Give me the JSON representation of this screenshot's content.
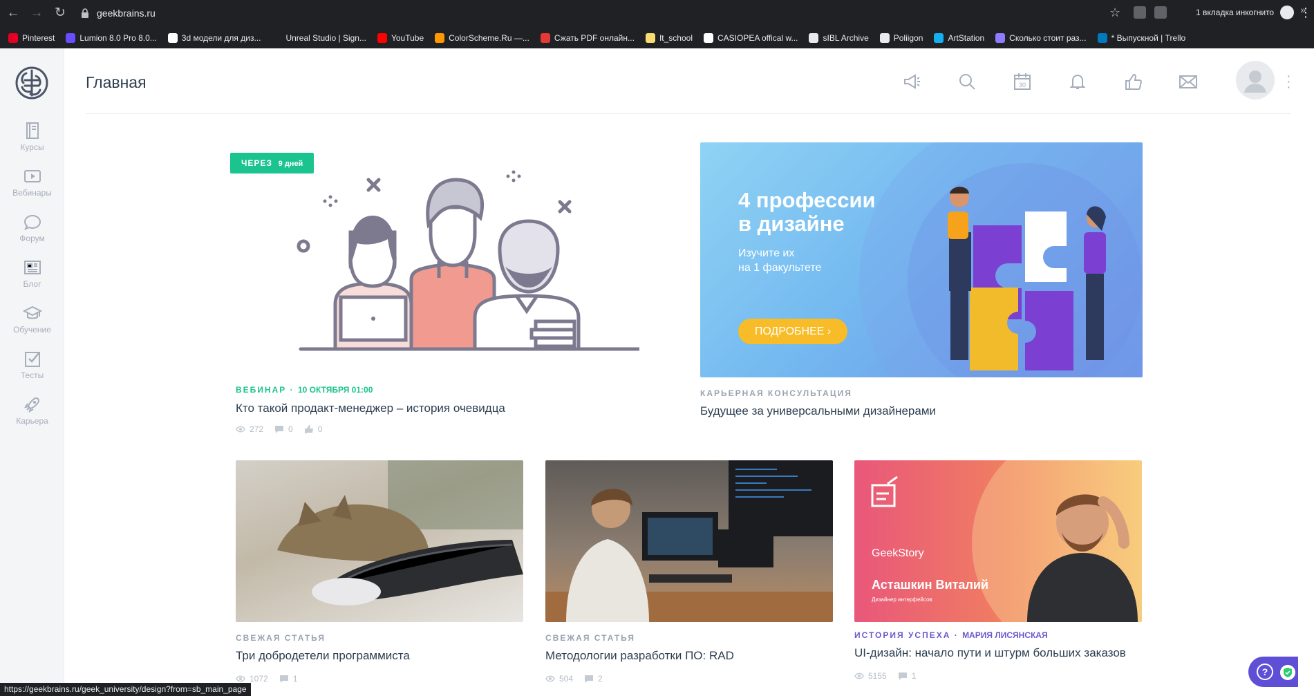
{
  "browser": {
    "url": "geekbrains.ru",
    "incognito_label": "1 вкладка инкогнито",
    "bookmarks": [
      {
        "label": "Pinterest",
        "color": "#e60023"
      },
      {
        "label": "Lumion 8.0 Pro 8.0...",
        "color": "#6a4cff"
      },
      {
        "label": "3d модели для диз...",
        "color": "#ffffff"
      },
      {
        "label": "Unreal Studio | Sign...",
        "color": "#202124"
      },
      {
        "label": "YouTube",
        "color": "#ff0000"
      },
      {
        "label": "ColorScheme.Ru —...",
        "color": "#ff9800"
      },
      {
        "label": "Сжать PDF онлайн...",
        "color": "#e53935"
      },
      {
        "label": "It_school",
        "color": "#f7dc6f"
      },
      {
        "label": "CASIOPEA offical w...",
        "color": "#ffffff"
      },
      {
        "label": "sIBL Archive",
        "color": "#e8eaed"
      },
      {
        "label": "Poliigon",
        "color": "#e8eaed"
      },
      {
        "label": "ArtStation",
        "color": "#13aff0"
      },
      {
        "label": "Сколько стоит раз...",
        "color": "#8e7cff"
      },
      {
        "label": "* Выпускной | Trello",
        "color": "#0079bf"
      }
    ]
  },
  "sidebar": {
    "items": [
      {
        "label": "Курсы",
        "icon": "book-icon"
      },
      {
        "label": "Вебинары",
        "icon": "play-icon"
      },
      {
        "label": "Форум",
        "icon": "chat-icon"
      },
      {
        "label": "Блог",
        "icon": "newspaper-icon"
      },
      {
        "label": "Обучение",
        "icon": "graduation-cap-icon"
      },
      {
        "label": "Тесты",
        "icon": "checkbox-icon"
      },
      {
        "label": "Карьера",
        "icon": "rocket-icon"
      }
    ]
  },
  "header": {
    "title": "Главная",
    "calendar_day": "30",
    "icons": [
      "megaphone-icon",
      "search-icon",
      "calendar-icon",
      "bell-icon",
      "thumbs-up-icon",
      "mail-icon"
    ]
  },
  "featured": {
    "badge_prefix": "ЧЕРЕЗ",
    "badge_suffix": "9 дней",
    "category": "ВЕБИНАР",
    "date": "10 октября 01:00",
    "title": "Кто такой продакт-менеджер – история очевидца",
    "views": "272",
    "comments": "0",
    "likes": "0"
  },
  "promo": {
    "title": "4 профессии\nв дизайне",
    "subtitle": "Изучите их\nна 1 факультете",
    "button": "ПОДРОБНЕЕ",
    "category": "КАРЬЕРНАЯ КОНСУЛЬТАЦИЯ",
    "card_title": "Будущее за универсальными дизайнерами"
  },
  "cards": [
    {
      "category": "СВЕЖАЯ СТАТЬЯ",
      "title": "Три добродетели программиста",
      "views": "1072",
      "comments": "1"
    },
    {
      "category": "СВЕЖАЯ СТАТЬЯ",
      "title": "Методологии разработки ПО: RAD",
      "views": "504",
      "comments": "2"
    },
    {
      "category": "ИСТОРИЯ УСПЕХА",
      "author": "Мария Лисянская",
      "title": "UI-дизайн: начало пути и штурм больших заказов",
      "views": "5155",
      "comments": "1",
      "image_caption": "GeekStory",
      "image_name": "Асташкин Виталий",
      "image_role": "Дизайнер интерфейсов"
    }
  ],
  "status_url": "https://geekbrains.ru/geek_university/design?from=sb_main_page",
  "help_label": "?"
}
